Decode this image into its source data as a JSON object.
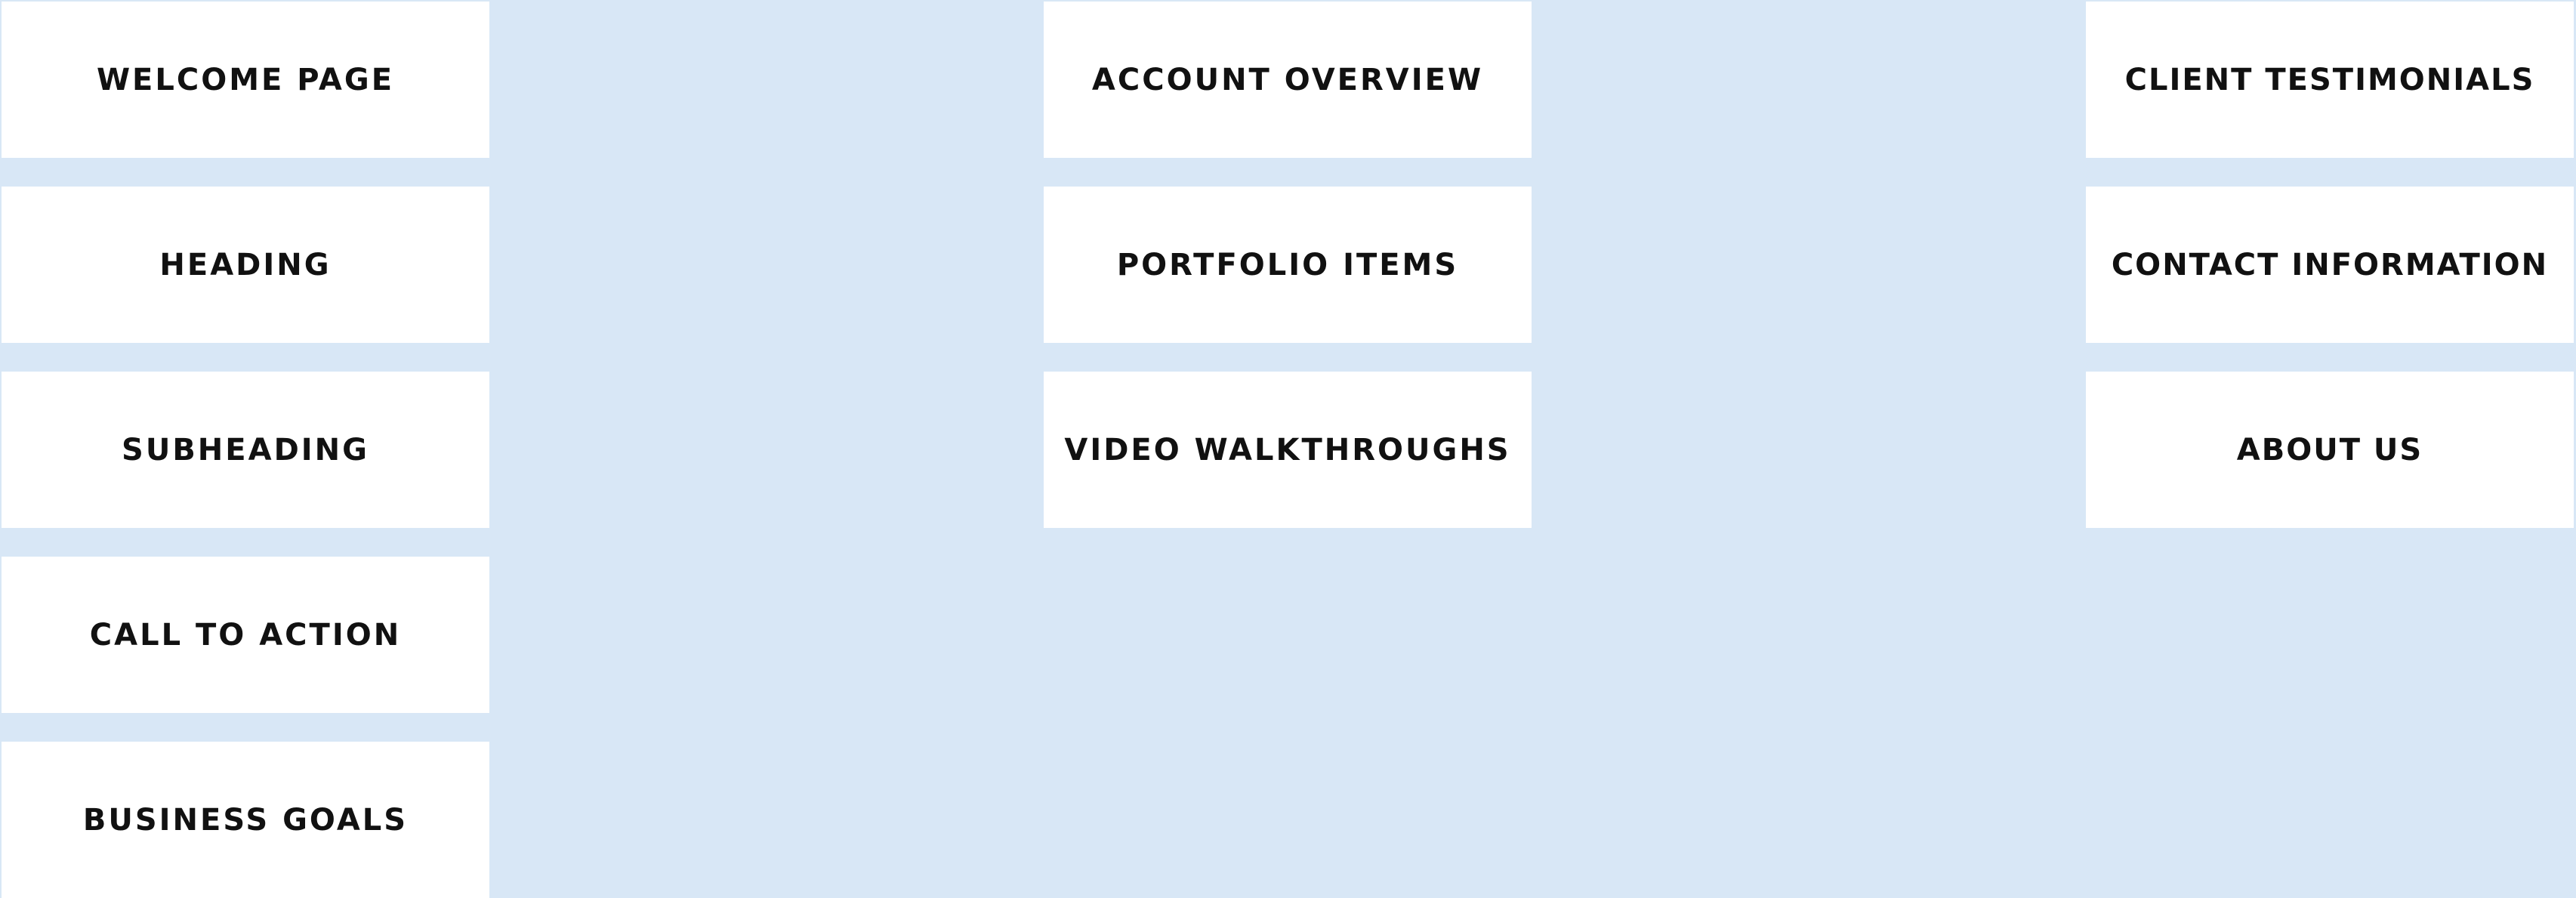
{
  "colors": {
    "background": "#d8e7f6",
    "card": "#ffffff",
    "text": "#111111"
  },
  "columns": [
    {
      "items": [
        {
          "label": "WELCOME PAGE"
        },
        {
          "label": "HEADING"
        },
        {
          "label": "SUBHEADING"
        },
        {
          "label": "CALL TO ACTION"
        },
        {
          "label": "BUSINESS GOALS"
        }
      ]
    },
    {
      "items": [
        {
          "label": "ACCOUNT OVERVIEW"
        },
        {
          "label": "PORTFOLIO ITEMS"
        },
        {
          "label": "VIDEO WALKTHROUGHS"
        }
      ]
    },
    {
      "items": [
        {
          "label": "CLIENT TESTIMONIALS"
        },
        {
          "label": "CONTACT INFORMATION"
        },
        {
          "label": "ABOUT US"
        }
      ]
    }
  ]
}
